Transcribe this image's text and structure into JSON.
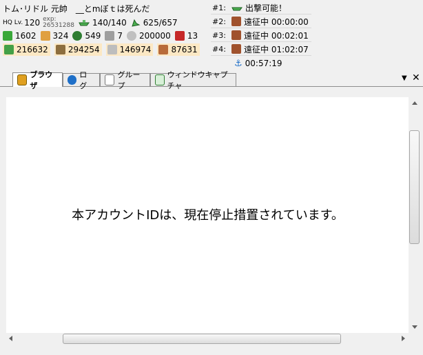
{
  "header": {
    "name": "トム･リドル 元帥",
    "comment": "__とmぼｔは死んだ",
    "hq_label": "HQ Lv.",
    "hq_level": "120",
    "exp_label": "exp:",
    "exp_value": "26531288",
    "ships": "140/140",
    "equipment": "625/657"
  },
  "resources_row1": [
    {
      "icon": "bucket-icon",
      "value": "1602"
    },
    {
      "icon": "flame-icon",
      "value": "324"
    },
    {
      "icon": "globe-icon",
      "value": "549"
    },
    {
      "icon": "screw-icon",
      "value": "7"
    },
    {
      "icon": "coin-icon",
      "value": "200000"
    },
    {
      "icon": "gift-icon",
      "value": "13"
    }
  ],
  "resources_row2": [
    {
      "icon": "fuel-icon",
      "value": "216632"
    },
    {
      "icon": "ammo-icon",
      "value": "294254"
    },
    {
      "icon": "steel-icon",
      "value": "146974"
    },
    {
      "icon": "bauxite-icon",
      "value": "87631"
    }
  ],
  "fleets": [
    {
      "num": "#1:",
      "status": "出撃可能！",
      "icon": "ship-icon"
    },
    {
      "num": "#2:",
      "status": "遠征中 00:00:00",
      "icon": "expedition-icon"
    },
    {
      "num": "#3:",
      "status": "遠征中 00:02:01",
      "icon": "expedition-icon"
    },
    {
      "num": "#4:",
      "status": "遠征中 01:02:07",
      "icon": "expedition-icon"
    }
  ],
  "anchor_timer": "00:57:19",
  "tabs": [
    {
      "label": "ブラウザ",
      "active": true
    },
    {
      "label": "ログ"
    },
    {
      "label": "グループ"
    },
    {
      "label": "ウィンドウキャプチャ"
    }
  ],
  "browser_message": "本アカウントIDは、現在停止措置されています。",
  "colors": {
    "highlight": "#fce8c4",
    "tab_border": "#8c8c8c",
    "accent_green": "#3aa83a"
  }
}
